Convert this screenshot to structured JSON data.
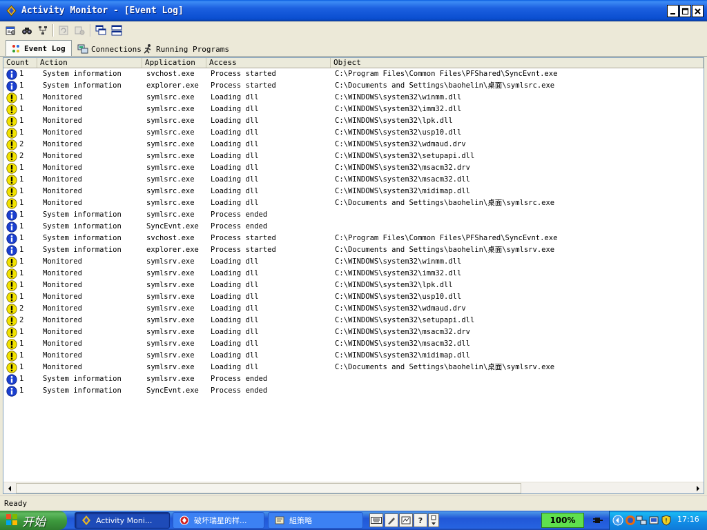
{
  "window": {
    "title": "Activity Monitor - [Event Log]"
  },
  "toolbar": {
    "icons": [
      "properties-icon",
      "find-icon",
      "tree-icon",
      "refresh-icon",
      "stop-icon",
      "cascade-icon",
      "tile-icon"
    ]
  },
  "tabs": [
    {
      "label": "Event Log",
      "icon": "event-log-icon",
      "active": true
    },
    {
      "label": "Connections",
      "icon": "connections-icon",
      "active": false
    },
    {
      "label": "Running Programs",
      "icon": "running-programs-icon",
      "active": false
    }
  ],
  "columns": {
    "count": "Count",
    "action": "Action",
    "application": "Application",
    "access": "Access",
    "object": "Object"
  },
  "rows": [
    {
      "type": "info",
      "count": "1",
      "action": "System information",
      "application": "svchost.exe",
      "access": "Process started",
      "object": "C:\\Program Files\\Common Files\\PFShared\\SyncEvnt.exe"
    },
    {
      "type": "info",
      "count": "1",
      "action": "System information",
      "application": "explorer.exe",
      "access": "Process started",
      "object": "C:\\Documents and Settings\\baohelin\\桌面\\symlsrc.exe"
    },
    {
      "type": "warn",
      "count": "1",
      "action": "Monitored",
      "application": "symlsrc.exe",
      "access": "Loading dll",
      "object": "C:\\WINDOWS\\system32\\winmm.dll"
    },
    {
      "type": "warn",
      "count": "1",
      "action": "Monitored",
      "application": "symlsrc.exe",
      "access": "Loading dll",
      "object": "C:\\WINDOWS\\system32\\imm32.dll"
    },
    {
      "type": "warn",
      "count": "1",
      "action": "Monitored",
      "application": "symlsrc.exe",
      "access": "Loading dll",
      "object": "C:\\WINDOWS\\system32\\lpk.dll"
    },
    {
      "type": "warn",
      "count": "1",
      "action": "Monitored",
      "application": "symlsrc.exe",
      "access": "Loading dll",
      "object": "C:\\WINDOWS\\system32\\usp10.dll"
    },
    {
      "type": "warn",
      "count": "2",
      "action": "Monitored",
      "application": "symlsrc.exe",
      "access": "Loading dll",
      "object": "C:\\WINDOWS\\system32\\wdmaud.drv"
    },
    {
      "type": "warn",
      "count": "2",
      "action": "Monitored",
      "application": "symlsrc.exe",
      "access": "Loading dll",
      "object": "C:\\WINDOWS\\system32\\setupapi.dll"
    },
    {
      "type": "warn",
      "count": "1",
      "action": "Monitored",
      "application": "symlsrc.exe",
      "access": "Loading dll",
      "object": "C:\\WINDOWS\\system32\\msacm32.drv"
    },
    {
      "type": "warn",
      "count": "1",
      "action": "Monitored",
      "application": "symlsrc.exe",
      "access": "Loading dll",
      "object": "C:\\WINDOWS\\system32\\msacm32.dll"
    },
    {
      "type": "warn",
      "count": "1",
      "action": "Monitored",
      "application": "symlsrc.exe",
      "access": "Loading dll",
      "object": "C:\\WINDOWS\\system32\\midimap.dll"
    },
    {
      "type": "warn",
      "count": "1",
      "action": "Monitored",
      "application": "symlsrc.exe",
      "access": "Loading dll",
      "object": "C:\\Documents and Settings\\baohelin\\桌面\\symlsrc.exe"
    },
    {
      "type": "info",
      "count": "1",
      "action": "System information",
      "application": "symlsrc.exe",
      "access": "Process ended",
      "object": ""
    },
    {
      "type": "info",
      "count": "1",
      "action": "System information",
      "application": "SyncEvnt.exe",
      "access": "Process ended",
      "object": ""
    },
    {
      "type": "info",
      "count": "1",
      "action": "System information",
      "application": "svchost.exe",
      "access": "Process started",
      "object": "C:\\Program Files\\Common Files\\PFShared\\SyncEvnt.exe"
    },
    {
      "type": "info",
      "count": "1",
      "action": "System information",
      "application": "explorer.exe",
      "access": "Process started",
      "object": "C:\\Documents and Settings\\baohelin\\桌面\\symlsrv.exe"
    },
    {
      "type": "warn",
      "count": "1",
      "action": "Monitored",
      "application": "symlsrv.exe",
      "access": "Loading dll",
      "object": "C:\\WINDOWS\\system32\\winmm.dll"
    },
    {
      "type": "warn",
      "count": "1",
      "action": "Monitored",
      "application": "symlsrv.exe",
      "access": "Loading dll",
      "object": "C:\\WINDOWS\\system32\\imm32.dll"
    },
    {
      "type": "warn",
      "count": "1",
      "action": "Monitored",
      "application": "symlsrv.exe",
      "access": "Loading dll",
      "object": "C:\\WINDOWS\\system32\\lpk.dll"
    },
    {
      "type": "warn",
      "count": "1",
      "action": "Monitored",
      "application": "symlsrv.exe",
      "access": "Loading dll",
      "object": "C:\\WINDOWS\\system32\\usp10.dll"
    },
    {
      "type": "warn",
      "count": "2",
      "action": "Monitored",
      "application": "symlsrv.exe",
      "access": "Loading dll",
      "object": "C:\\WINDOWS\\system32\\wdmaud.drv"
    },
    {
      "type": "warn",
      "count": "2",
      "action": "Monitored",
      "application": "symlsrv.exe",
      "access": "Loading dll",
      "object": "C:\\WINDOWS\\system32\\setupapi.dll"
    },
    {
      "type": "warn",
      "count": "1",
      "action": "Monitored",
      "application": "symlsrv.exe",
      "access": "Loading dll",
      "object": "C:\\WINDOWS\\system32\\msacm32.drv"
    },
    {
      "type": "warn",
      "count": "1",
      "action": "Monitored",
      "application": "symlsrv.exe",
      "access": "Loading dll",
      "object": "C:\\WINDOWS\\system32\\msacm32.dll"
    },
    {
      "type": "warn",
      "count": "1",
      "action": "Monitored",
      "application": "symlsrv.exe",
      "access": "Loading dll",
      "object": "C:\\WINDOWS\\system32\\midimap.dll"
    },
    {
      "type": "warn",
      "count": "1",
      "action": "Monitored",
      "application": "symlsrv.exe",
      "access": "Loading dll",
      "object": "C:\\Documents and Settings\\baohelin\\桌面\\symlsrv.exe"
    },
    {
      "type": "info",
      "count": "1",
      "action": "System information",
      "application": "symlsrv.exe",
      "access": "Process ended",
      "object": ""
    },
    {
      "type": "info",
      "count": "1",
      "action": "System information",
      "application": "SyncEvnt.exe",
      "access": "Process ended",
      "object": ""
    }
  ],
  "status": {
    "text": "Ready"
  },
  "taskbar": {
    "start_label": "开始",
    "tasks": [
      {
        "label": "Activity Moni...",
        "icon": "activity-monitor-icon",
        "active": true
      },
      {
        "label": "破坏瑞星的样...",
        "icon": "rising-icon",
        "active": false
      },
      {
        "label": "組策略",
        "icon": "group-policy-icon",
        "active": false
      }
    ],
    "zoom": "100%",
    "clock": "17:16"
  },
  "colors": {
    "info": "#1a3fd0",
    "warn": "#f2e300",
    "titlebar": "#0a4ed0",
    "taskbar": "#2663e0"
  }
}
